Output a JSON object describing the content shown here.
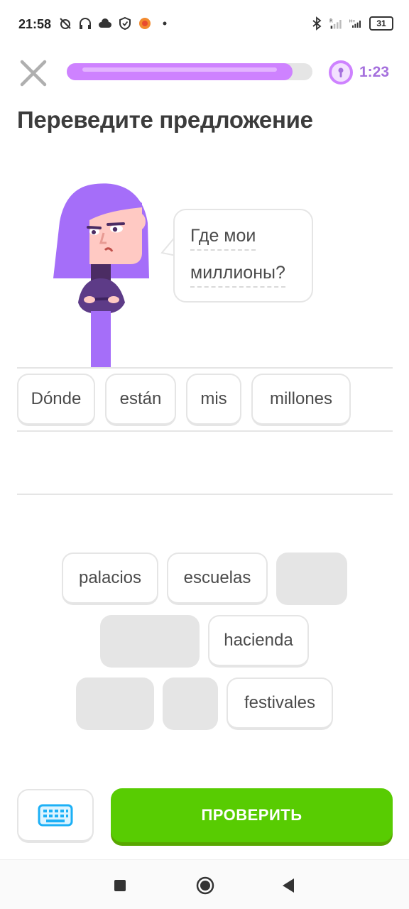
{
  "status_bar": {
    "time": "21:58",
    "battery": "31",
    "icons_left": [
      "alarm-off-icon",
      "headphones-icon",
      "cloud-icon",
      "shield-icon",
      "app-notification-icon",
      "dot-icon"
    ],
    "icons_right": [
      "bluetooth-icon",
      "signal-r-icon",
      "signal-h-icon",
      "battery-icon"
    ]
  },
  "header": {
    "progress_fraction": 0.92,
    "timer": "1:23"
  },
  "prompt": {
    "title": "Переведите предложение"
  },
  "speech": {
    "line1": "Где мои",
    "line2": "миллионы?"
  },
  "answer": {
    "tiles": [
      "Dónde",
      "están",
      "mis",
      "millones"
    ]
  },
  "word_bank": {
    "row1": [
      "palacios",
      "escuelas"
    ],
    "row2": [
      "hacienda"
    ],
    "row3": [
      "festivales"
    ]
  },
  "actions": {
    "check_label": "ПРОВЕРИТЬ"
  },
  "colors": {
    "accent_green": "#58cc02",
    "accent_purple": "#ce82ff",
    "timer_purple": "#a570dd",
    "keyboard_blue": "#1cb0f6"
  }
}
